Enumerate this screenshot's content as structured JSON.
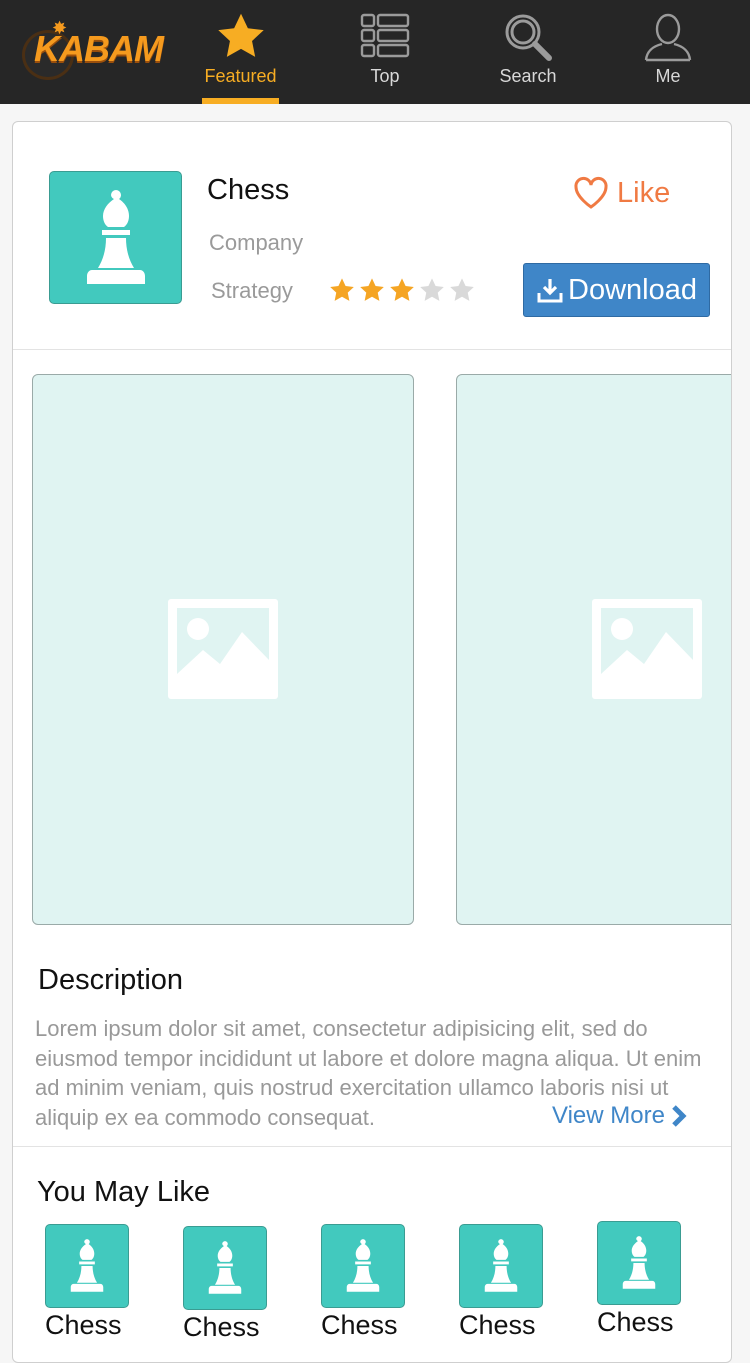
{
  "nav": {
    "logo_text": "KABAM",
    "tabs": [
      {
        "label": "Featured",
        "icon": "star-icon",
        "active": true
      },
      {
        "label": "Top",
        "icon": "list-icon",
        "active": false
      },
      {
        "label": "Search",
        "icon": "search-icon",
        "active": false
      },
      {
        "label": "Me",
        "icon": "user-icon",
        "active": false
      }
    ],
    "accent_color": "#f7ad23"
  },
  "app": {
    "title": "Chess",
    "company": "Company",
    "category": "Strategy",
    "rating": 3,
    "rating_max": 5,
    "like_label": "Like",
    "download_label": "Download",
    "icon": "chess-bishop-icon"
  },
  "screenshots": [
    {
      "icon": "image-placeholder-icon"
    },
    {
      "icon": "image-placeholder-icon"
    }
  ],
  "description": {
    "heading": "Description",
    "body": "Lorem ipsum dolor sit amet, consectetur adipisicing elit, sed do eiusmod tempor incididunt ut labore et dolore magna aliqua. Ut enim ad minim veniam, quis nostrud exercitation ullamco laboris nisi ut aliquip ex ea commodo consequat.",
    "view_more": "View More"
  },
  "you_may_like": {
    "heading": "You May Like",
    "items": [
      {
        "label": "Chess"
      },
      {
        "label": "Chess"
      },
      {
        "label": "Chess"
      },
      {
        "label": "Chess"
      },
      {
        "label": "Chess"
      }
    ]
  },
  "colors": {
    "tile": "#42c9be",
    "screenshot_bg": "#e0f4f2",
    "download": "#3f86c8",
    "like": "#f07a43",
    "star_on": "#f5a524",
    "star_off": "#d9d9d9"
  }
}
